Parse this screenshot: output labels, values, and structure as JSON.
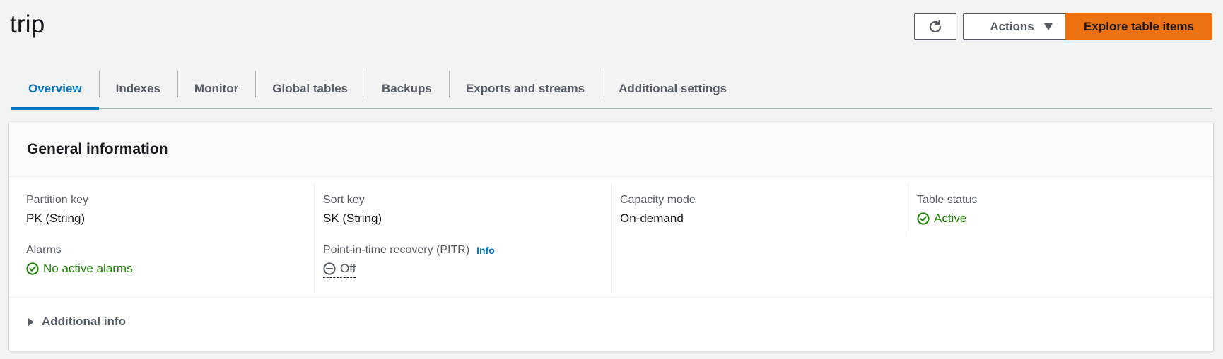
{
  "page": {
    "title": "trip"
  },
  "toolbar": {
    "refresh_icon": "refresh-icon",
    "actions_label": "Actions",
    "actions_icon": "caret-down-icon",
    "explore_label": "Explore table items"
  },
  "tabs": [
    {
      "label": "Overview",
      "active": true
    },
    {
      "label": "Indexes",
      "active": false
    },
    {
      "label": "Monitor",
      "active": false
    },
    {
      "label": "Global tables",
      "active": false
    },
    {
      "label": "Backups",
      "active": false
    },
    {
      "label": "Exports and streams",
      "active": false
    },
    {
      "label": "Additional settings",
      "active": false
    }
  ],
  "general": {
    "title": "General information",
    "partition_key": {
      "label": "Partition key",
      "value": "PK (String)"
    },
    "sort_key": {
      "label": "Sort key",
      "value": "SK (String)"
    },
    "capacity_mode": {
      "label": "Capacity mode",
      "value": "On-demand"
    },
    "table_status": {
      "label": "Table status",
      "value": "Active",
      "icon": "check-circle-icon"
    },
    "alarms": {
      "label": "Alarms",
      "value": "No active alarms",
      "icon": "check-circle-icon"
    },
    "pitr": {
      "label": "Point-in-time recovery (PITR)",
      "info": "Info",
      "value": "Off",
      "icon": "minus-circle-icon"
    }
  },
  "additional": {
    "label": "Additional info",
    "icon": "caret-right-icon"
  },
  "colors": {
    "accent": "#0073bb",
    "primary_button": "#ec7211",
    "success": "#1d8102",
    "text": "#16191f",
    "secondary_text": "#545b64"
  }
}
